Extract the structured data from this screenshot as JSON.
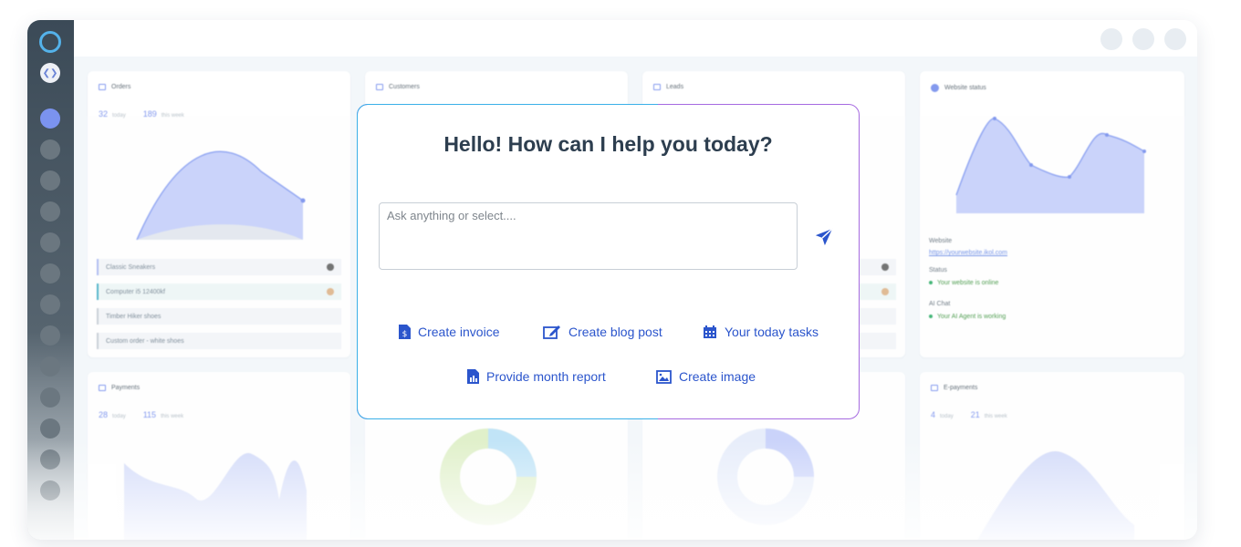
{
  "modal": {
    "title": "Hello! How can I help you today?",
    "input_placeholder": "Ask anything or select....",
    "actions": [
      {
        "label": "Create invoice",
        "icon": "invoice-icon"
      },
      {
        "label": "Create blog post",
        "icon": "edit-icon"
      },
      {
        "label": "Your today tasks",
        "icon": "calendar-icon"
      },
      {
        "label": "Provide month report",
        "icon": "report-icon"
      },
      {
        "label": "Create image",
        "icon": "image-icon"
      }
    ]
  },
  "cards": {
    "orders": {
      "title": "Orders",
      "today_value": "32",
      "today_label": "today",
      "week_value": "189",
      "week_label": "this week"
    },
    "customers": {
      "title": "Customers"
    },
    "leads": {
      "title": "Leads"
    },
    "website_status": {
      "title": "Website status",
      "website_label": "Website",
      "website_url": "https://yourwebsite.ikol.com",
      "status_label": "Status",
      "status_text": "Your website is online",
      "ai_label": "AI Chat",
      "ai_text": "Your AI Agent is working"
    },
    "payments": {
      "title": "Payments",
      "today_value": "28",
      "today_label": "today",
      "week_value": "115",
      "week_label": "this week"
    },
    "epayments": {
      "title": "E-payments",
      "today_value": "4",
      "today_label": "today",
      "week_value": "21",
      "week_label": "this week"
    }
  },
  "order_items": [
    "Classic Sneakers",
    "Computer i5 12400kf",
    "Timber Hiker shoes",
    "Custom order - white shoes"
  ],
  "colors": {
    "accent": "#2b55cc",
    "chart": "#7e95ee",
    "sidebar": "#3b4a57"
  }
}
